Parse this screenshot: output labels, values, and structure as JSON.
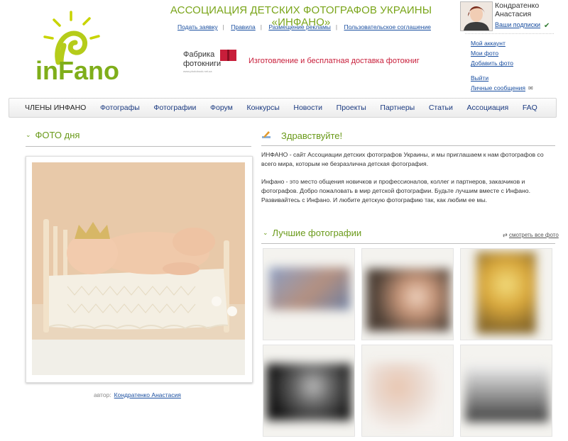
{
  "header": {
    "logo_text": "inFano",
    "site_title": "АССОЦИАЦИЯ ДЕТСКИХ ФОТОГРАФОВ УКРАИНЫ «ИНФАНО»",
    "top_links": [
      "Подать заявку",
      "Правила",
      "Размещение рекламы",
      "Пользовательское соглашение"
    ],
    "promo": {
      "brand_line1": "Фабрика",
      "brand_line2": "фотокниги",
      "brand_small": "www.photobook.net.ua",
      "text": "Изготовление и бесплатная доставка фотокниг"
    }
  },
  "user": {
    "name": "Кондратенко Анастасия",
    "subscriptions_label": "Ваши подписки",
    "menu": [
      "Мой аккаунт",
      "Мои фото",
      "Добавить фото",
      "Выйти",
      "Личные сообщения"
    ]
  },
  "nav": {
    "items": [
      "ЧЛЕНЫ ИНФАНО",
      "Фотографы",
      "Фотографии",
      "Форум",
      "Конкурсы",
      "Новости",
      "Проекты",
      "Партнеры",
      "Статьи",
      "Ассоциация",
      "FAQ"
    ]
  },
  "photo_of_day": {
    "title": "ФОТО дня",
    "author_label": "автор:",
    "author_name": "Кондратенко Анастасия"
  },
  "welcome": {
    "title": "Здравствуйте!",
    "paragraph1": "ИНФАНО - сайт Ассоциации детских фотографов Украины, и мы приглашаем к нам фотографов со всего мира, которым не безразлична детская фотография.",
    "paragraph2": "Инфано - это место общения новичков и профессионалов, коллег и партнеров, заказчиков и фотографов. Добро пожаловать в мир детской фотографии. Будьте лучшим вместе с Инфано. Развивайтесь с Инфано. И любите детскую фотографию так, как любим ее мы."
  },
  "best_photos": {
    "title": "Лучшие  фотографии",
    "see_all": "смотреть все фото"
  },
  "colors": {
    "accent_green": "#6a9a1a",
    "title_green": "#7aa51a",
    "link_blue": "#1a4fa0",
    "promo_red": "#c81e3a"
  }
}
